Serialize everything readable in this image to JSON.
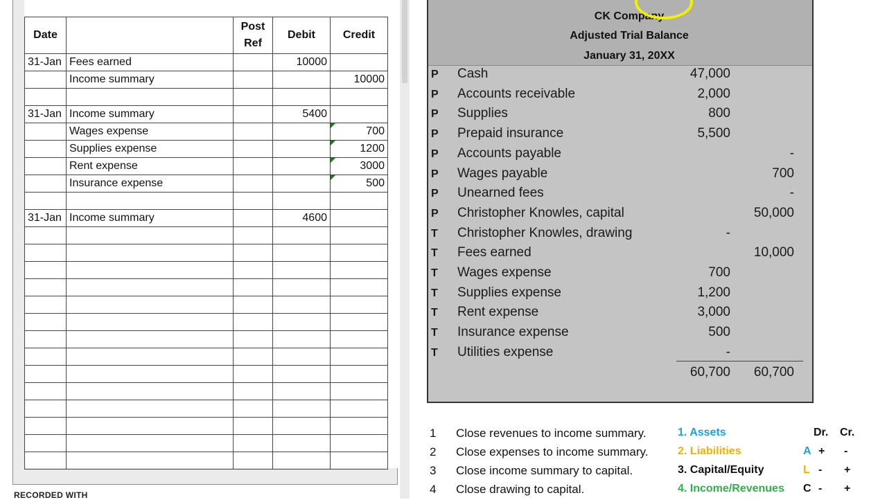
{
  "journal": {
    "headers": {
      "date": "Date",
      "account": "",
      "post_ref_line1": "Post",
      "post_ref_line2": "Ref",
      "debit": "Debit",
      "credit": "Credit"
    },
    "rows": [
      {
        "date": "31-Jan",
        "account": "Fees earned",
        "indent": false,
        "debit": "10000",
        "credit": "",
        "flag": false
      },
      {
        "date": "",
        "account": "Income summary",
        "indent": true,
        "debit": "",
        "credit": "10000",
        "flag": false
      },
      {
        "date": "",
        "account": "",
        "indent": false,
        "debit": "",
        "credit": "",
        "flag": false
      },
      {
        "date": "31-Jan",
        "account": "Income summary",
        "indent": false,
        "debit": "5400",
        "credit": "",
        "flag": false
      },
      {
        "date": "",
        "account": "Wages expense",
        "indent": true,
        "debit": "",
        "credit": "700",
        "flag": true
      },
      {
        "date": "",
        "account": "Supplies expense",
        "indent": true,
        "debit": "",
        "credit": "1200",
        "flag": true
      },
      {
        "date": "",
        "account": "Rent expense",
        "indent": true,
        "debit": "",
        "credit": "3000",
        "flag": true
      },
      {
        "date": "",
        "account": "Insurance expense",
        "indent": true,
        "debit": "",
        "credit": "500",
        "flag": true
      },
      {
        "date": "",
        "account": "",
        "indent": false,
        "debit": "",
        "credit": "",
        "flag": false
      },
      {
        "date": "31-Jan",
        "account": "Income summary",
        "indent": false,
        "debit": "4600",
        "credit": "",
        "flag": false
      },
      {
        "date": "",
        "account": "",
        "indent": false,
        "debit": "",
        "credit": "",
        "flag": false
      },
      {
        "date": "",
        "account": "",
        "indent": false,
        "debit": "",
        "credit": "",
        "flag": false
      },
      {
        "date": "",
        "account": "",
        "indent": false,
        "debit": "",
        "credit": "",
        "flag": false
      },
      {
        "date": "",
        "account": "",
        "indent": false,
        "debit": "",
        "credit": "",
        "flag": false
      },
      {
        "date": "",
        "account": "",
        "indent": false,
        "debit": "",
        "credit": "",
        "flag": false
      },
      {
        "date": "",
        "account": "",
        "indent": false,
        "debit": "",
        "credit": "",
        "flag": false
      },
      {
        "date": "",
        "account": "",
        "indent": false,
        "debit": "",
        "credit": "",
        "flag": false
      },
      {
        "date": "",
        "account": "",
        "indent": false,
        "debit": "",
        "credit": "",
        "flag": false
      },
      {
        "date": "",
        "account": "",
        "indent": false,
        "debit": "",
        "credit": "",
        "flag": false
      },
      {
        "date": "",
        "account": "",
        "indent": false,
        "debit": "",
        "credit": "",
        "flag": false
      },
      {
        "date": "",
        "account": "",
        "indent": false,
        "debit": "",
        "credit": "",
        "flag": false
      },
      {
        "date": "",
        "account": "",
        "indent": false,
        "debit": "",
        "credit": "",
        "flag": false
      },
      {
        "date": "",
        "account": "",
        "indent": false,
        "debit": "",
        "credit": "",
        "flag": false
      },
      {
        "date": "",
        "account": "",
        "indent": false,
        "debit": "",
        "credit": "",
        "flag": false
      }
    ]
  },
  "recorded_with": "RECORDED WITH",
  "trial_balance": {
    "company": "CK Company",
    "title": "Adjusted Trial Balance",
    "date": "January 31, 20XX",
    "rows": [
      {
        "type": "P",
        "account": "Cash",
        "debit": "47,000",
        "credit": ""
      },
      {
        "type": "P",
        "account": "Accounts receivable",
        "debit": "2,000",
        "credit": ""
      },
      {
        "type": "P",
        "account": "Supplies",
        "debit": "800",
        "credit": ""
      },
      {
        "type": "P",
        "account": "Prepaid insurance",
        "debit": "5,500",
        "credit": ""
      },
      {
        "type": "P",
        "account": "Accounts payable",
        "debit": "",
        "credit": "-"
      },
      {
        "type": "P",
        "account": "Wages payable",
        "debit": "",
        "credit": "700"
      },
      {
        "type": "P",
        "account": "Unearned fees",
        "debit": "",
        "credit": "-"
      },
      {
        "type": "P",
        "account": "Christopher Knowles, capital",
        "debit": "",
        "credit": "50,000"
      },
      {
        "type": "T",
        "account": "Christopher Knowles, drawing",
        "debit": "-",
        "credit": ""
      },
      {
        "type": "T",
        "account": "Fees earned",
        "debit": "",
        "credit": "10,000"
      },
      {
        "type": "T",
        "account": "Wages expense",
        "debit": "700",
        "credit": ""
      },
      {
        "type": "T",
        "account": "Supplies expense",
        "debit": "1,200",
        "credit": ""
      },
      {
        "type": "T",
        "account": "Rent expense",
        "debit": "3,000",
        "credit": ""
      },
      {
        "type": "T",
        "account": "Insurance expense",
        "debit": "500",
        "credit": ""
      },
      {
        "type": "T",
        "account": "Utilities expense",
        "debit": "-",
        "credit": ""
      }
    ],
    "total_debit": "60,700",
    "total_credit": "60,700"
  },
  "steps": [
    {
      "num": "1",
      "text": "Close revenues to income summary."
    },
    {
      "num": "2",
      "text": "Close expenses to income summary."
    },
    {
      "num": "3",
      "text": "Close income summary to capital."
    },
    {
      "num": "4",
      "text": "Close drawing to capital."
    }
  ],
  "legend": [
    {
      "label": "1. Assets",
      "color": "#1ba1e2"
    },
    {
      "label": "2. Liabilities",
      "color": "#f0b400"
    },
    {
      "label": "3. Capital/Equity",
      "color": "#111111"
    },
    {
      "label": "4. Income/Revenues",
      "color": "#2db34a"
    }
  ],
  "drcr": {
    "header_dr": "Dr.",
    "header_cr": "Cr.",
    "rows": [
      {
        "letter": "A",
        "letter_color": "#1ba1e2",
        "dr": "+",
        "cr": "-"
      },
      {
        "letter": "L",
        "letter_color": "#f0b400",
        "dr": "-",
        "cr": "+"
      },
      {
        "letter": "C",
        "letter_color": "#111111",
        "dr": "-",
        "cr": "+"
      }
    ]
  }
}
